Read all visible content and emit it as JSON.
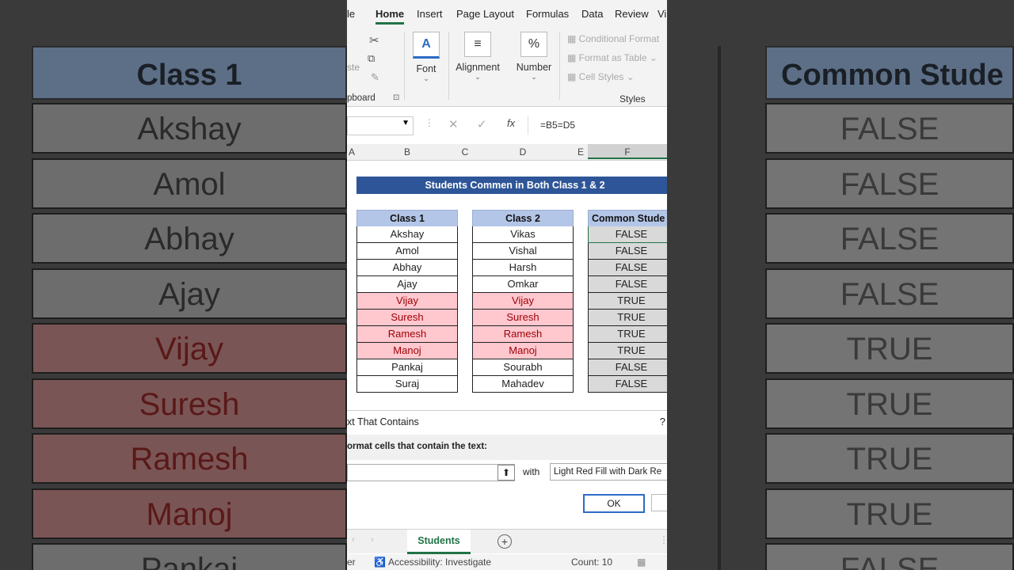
{
  "background": {
    "left_header": "Class 1",
    "left_names": [
      "Akshay",
      "Amol",
      "Abhay",
      "Ajay",
      "Vijay",
      "Suresh",
      "Ramesh",
      "Manoj",
      "Pankaj"
    ],
    "right_header": "Common Stude",
    "right_values": [
      "FALSE",
      "FALSE",
      "FALSE",
      "FALSE",
      "TRUE",
      "TRUE",
      "TRUE",
      "TRUE",
      "FALSE"
    ]
  },
  "menu": {
    "file": "le",
    "home": "Home",
    "insert": "Insert",
    "page_layout": "Page Layout",
    "formulas": "Formulas",
    "data": "Data",
    "review": "Review",
    "view": "Vi"
  },
  "ribbon": {
    "clipboard": "pboard",
    "paste": "ste",
    "font": "Font",
    "alignment": "Alignment",
    "number": "Number",
    "conditional": "Conditional Format",
    "format_table": "Format as Table",
    "cell_styles": "Cell Styles",
    "styles": "Styles"
  },
  "formula_bar": {
    "formula": "=B5=D5"
  },
  "columns": [
    "A",
    "B",
    "C",
    "D",
    "E",
    "F"
  ],
  "sheet": {
    "title": "Students Commen in Both Class 1 & 2",
    "class1": {
      "header": "Class 1",
      "values": [
        "Akshay",
        "Amol",
        "Abhay",
        "Ajay",
        "Vijay",
        "Suresh",
        "Ramesh",
        "Manoj",
        "Pankaj",
        "Suraj"
      ]
    },
    "class2": {
      "header": "Class 2",
      "values": [
        "Vikas",
        "Vishal",
        "Harsh",
        "Omkar",
        "Vijay",
        "Suresh",
        "Ramesh",
        "Manoj",
        "Sourabh",
        "Mahadev"
      ]
    },
    "common": {
      "header": "Common Stude",
      "values": [
        "FALSE",
        "FALSE",
        "FALSE",
        "FALSE",
        "TRUE",
        "TRUE",
        "TRUE",
        "TRUE",
        "FALSE",
        "FALSE"
      ]
    },
    "highlight_color": "#ffc7ce"
  },
  "dialog": {
    "title": "xt That Contains",
    "help": "?",
    "subtitle": "ormat cells that contain the text:",
    "with": "with",
    "format": "Light Red Fill with Dark Re",
    "ok": "OK"
  },
  "tabs": {
    "sheet": "Students",
    "add": "+"
  },
  "status": {
    "left": "er",
    "accessibility": "Accessibility: Investigate",
    "count": "Count: 10"
  }
}
